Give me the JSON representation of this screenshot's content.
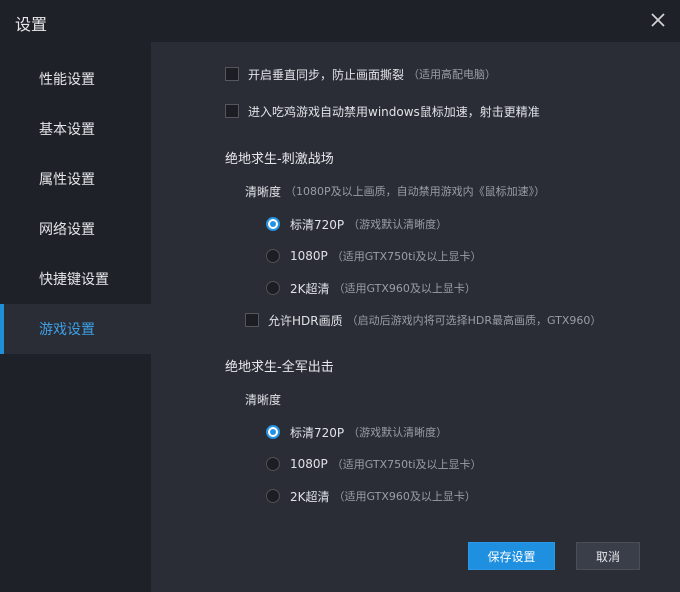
{
  "window": {
    "title": "设置"
  },
  "sidebar": {
    "items": [
      {
        "label": "性能设置"
      },
      {
        "label": "基本设置"
      },
      {
        "label": "属性设置"
      },
      {
        "label": "网络设置"
      },
      {
        "label": "快捷键设置"
      },
      {
        "label": "游戏设置"
      }
    ],
    "active_index": 5
  },
  "options": {
    "vsync": {
      "label": "开启垂直同步，防止画面撕裂",
      "note": "（适用高配电脑）",
      "checked": false
    },
    "mouse_accel": {
      "label": "进入吃鸡游戏自动禁用windows鼠标加速，射击更精准",
      "checked": false
    }
  },
  "section1": {
    "title": "绝地求生-刺激战场",
    "clarity_label": "清晰度",
    "clarity_note": "（1080P及以上画质，自动禁用游戏内《鼠标加速》）",
    "radios": [
      {
        "label": "标清720P",
        "note": "（游戏默认清晰度）",
        "checked": true
      },
      {
        "label": "1080P",
        "note": "（适用GTX750ti及以上显卡）",
        "checked": false
      },
      {
        "label": "2K超清",
        "note": "（适用GTX960及以上显卡）",
        "checked": false
      }
    ],
    "hdr": {
      "label": "允许HDR画质",
      "note": "（启动后游戏内将可选择HDR最高画质，GTX960）",
      "checked": false
    }
  },
  "section2": {
    "title": "绝地求生-全军出击",
    "clarity_label": "清晰度",
    "radios": [
      {
        "label": "标清720P",
        "note": "（游戏默认清晰度）",
        "checked": true
      },
      {
        "label": "1080P",
        "note": "（适用GTX750ti及以上显卡）",
        "checked": false
      },
      {
        "label": "2K超清",
        "note": "（适用GTX960及以上显卡）",
        "checked": false
      }
    ]
  },
  "buttons": {
    "save": "保存设置",
    "cancel": "取消"
  },
  "colors": {
    "accent": "#1f8fe0",
    "panel": "#2a2d36",
    "sidebar": "#1e2127"
  }
}
